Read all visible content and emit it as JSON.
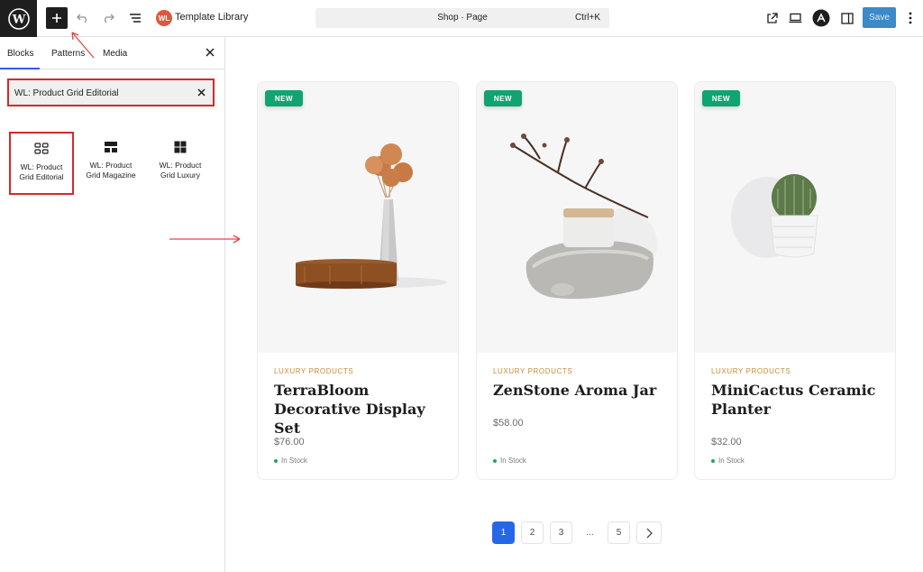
{
  "topbar": {
    "wp_logo": "wordpress-logo",
    "add_block": "plus-icon",
    "undo": "undo-icon",
    "redo": "redo-icon",
    "list_view": "list-view-icon",
    "template_library_logo": "WL",
    "template_library_label": "Template Library",
    "command": {
      "title": "Shop · Page",
      "shortcut": "Ctrl+K"
    },
    "view_external": "external-link-icon",
    "preview_device": "laptop-icon",
    "astra": "astra-logo-icon",
    "settings": "sidebar-toggle-icon",
    "options": "more-vertical-icon",
    "save_label": "Save"
  },
  "inserter": {
    "tabs": [
      {
        "label": "Blocks",
        "active": true
      },
      {
        "label": "Patterns",
        "active": false
      },
      {
        "label": "Media",
        "active": false
      }
    ],
    "search_value": "WL: Product Grid Editorial",
    "blocks": [
      {
        "line1": "WL: Product",
        "line2": "Grid Editorial",
        "icon": "grid-editorial-icon",
        "selected": true
      },
      {
        "line1": "WL: Product",
        "line2": "Grid Magazine",
        "icon": "grid-magazine-icon",
        "selected": false
      },
      {
        "line1": "WL: Product",
        "line2": "Grid Luxury",
        "icon": "grid-luxury-icon",
        "selected": false
      }
    ]
  },
  "products": [
    {
      "badge": "NEW",
      "category": "LUXURY PRODUCTS",
      "title": "TerraBloom Decorative Display Set",
      "price": "$76.00",
      "stock": "In Stock"
    },
    {
      "badge": "NEW",
      "category": "LUXURY PRODUCTS",
      "title": "ZenStone Aroma Jar",
      "price": "$58.00",
      "stock": "In Stock"
    },
    {
      "badge": "NEW",
      "category": "LUXURY PRODUCTS",
      "title": "MiniCactus Ceramic Planter",
      "price": "$32.00",
      "stock": "In Stock"
    }
  ],
  "pagination": {
    "pages": [
      "1",
      "2",
      "3",
      "...",
      "5"
    ],
    "current": "1",
    "next_icon": "chevron-right-icon"
  },
  "colors": {
    "accent": "#2667e8",
    "badge": "#11a372",
    "category": "#c98b34",
    "annotation": "#e04848",
    "save": "#3c8ac8"
  }
}
